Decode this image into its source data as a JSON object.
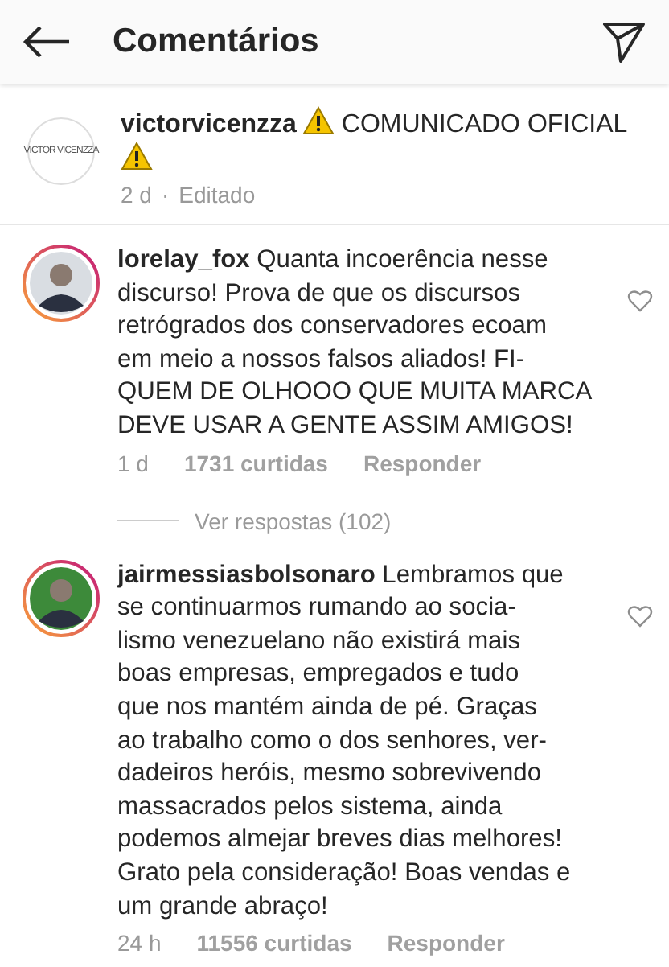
{
  "header": {
    "title": "Comentários"
  },
  "post": {
    "avatar_text": "VICTOR VICENZZA",
    "username": "victorvicenzza",
    "text": "COMUNICADO OFICIAL",
    "time": "2 d",
    "separator": "·",
    "edited": "Editado"
  },
  "comments": [
    {
      "username": "lorelay_fox",
      "text": "Quanta incoerência nesse\ndiscurso! Prova de que os discursos\nretrógrados dos conservadores ecoam\nem meio a nossos falsos aliados! FI-\nQUEM DE OLHOOO QUE MUITA MARCA\nDEVE USAR A GENTE ASSIM AMIGOS!",
      "time": "1 d",
      "likes": "1731 curtidas",
      "reply": "Responder",
      "liked": false,
      "view_replies": "Ver respostas (102)"
    },
    {
      "username": "jairmessiasbolsonaro",
      "text": "Lembramos que\nse continuarmos rumando ao socia-\nlismo venezuelano não existirá mais\nboas empresas, empregados e tudo\nque nos mantém ainda de pé. Graças\nao trabalho como o dos senhores, ver-\ndadeiros heróis, mesmo sobrevivendo\nmassacrados pelos sistema, ainda\npodemos almejar breves dias melhores!\nGrato pela consideração! Boas vendas e\num grande abraço!",
      "time": "24 h",
      "likes": "11556 curtidas",
      "reply": "Responder",
      "liked": false
    }
  ]
}
